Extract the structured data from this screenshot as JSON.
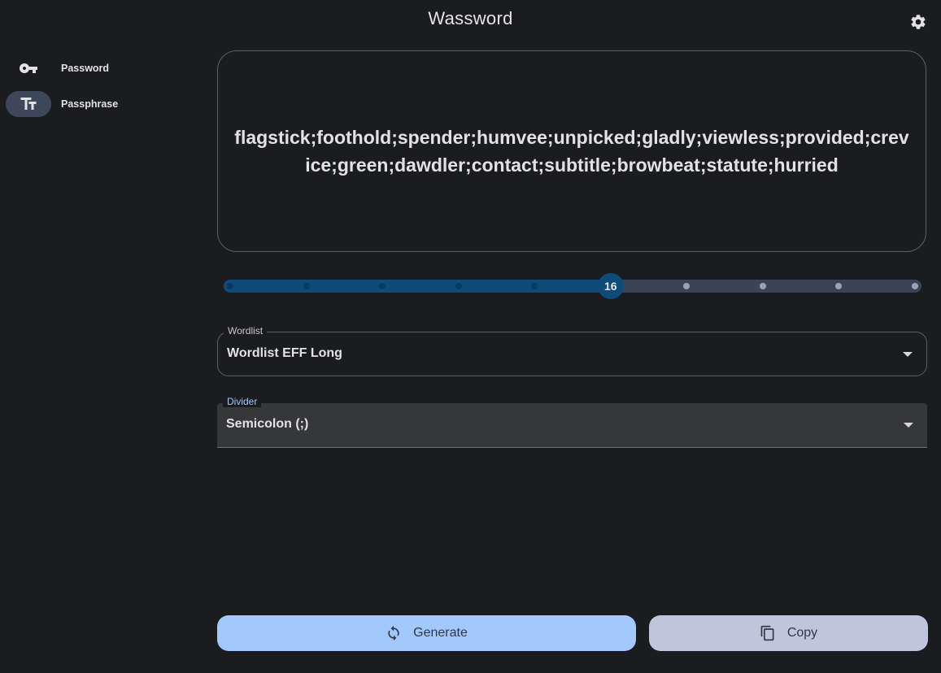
{
  "app": {
    "title": "Wassword"
  },
  "nav": {
    "items": [
      {
        "label": "Password",
        "icon": "key-icon",
        "active": false
      },
      {
        "label": "Passphrase",
        "icon": "text-fields-icon",
        "active": true
      }
    ]
  },
  "output": {
    "passphrase": "flagstick;foothold;spender;humvee;unpicked;gladly;viewless;provided;crevice;green;dawdler;contact;subtitle;browbeat;statute;hurried"
  },
  "slider": {
    "value": "16",
    "min": 6,
    "max": 24,
    "step": 2
  },
  "wordlist": {
    "label": "Wordlist",
    "value": "Wordlist EFF Long"
  },
  "divider": {
    "label": "Divider",
    "value": "Semicolon (;)"
  },
  "actions": {
    "generate_label": "Generate",
    "copy_label": "Copy"
  },
  "colors": {
    "background": "#1b1c20",
    "primary": "#a3c8fb",
    "secondary": "#bdc6da",
    "slider_active": "#0d4b78",
    "slider_inactive": "#3a4456"
  }
}
